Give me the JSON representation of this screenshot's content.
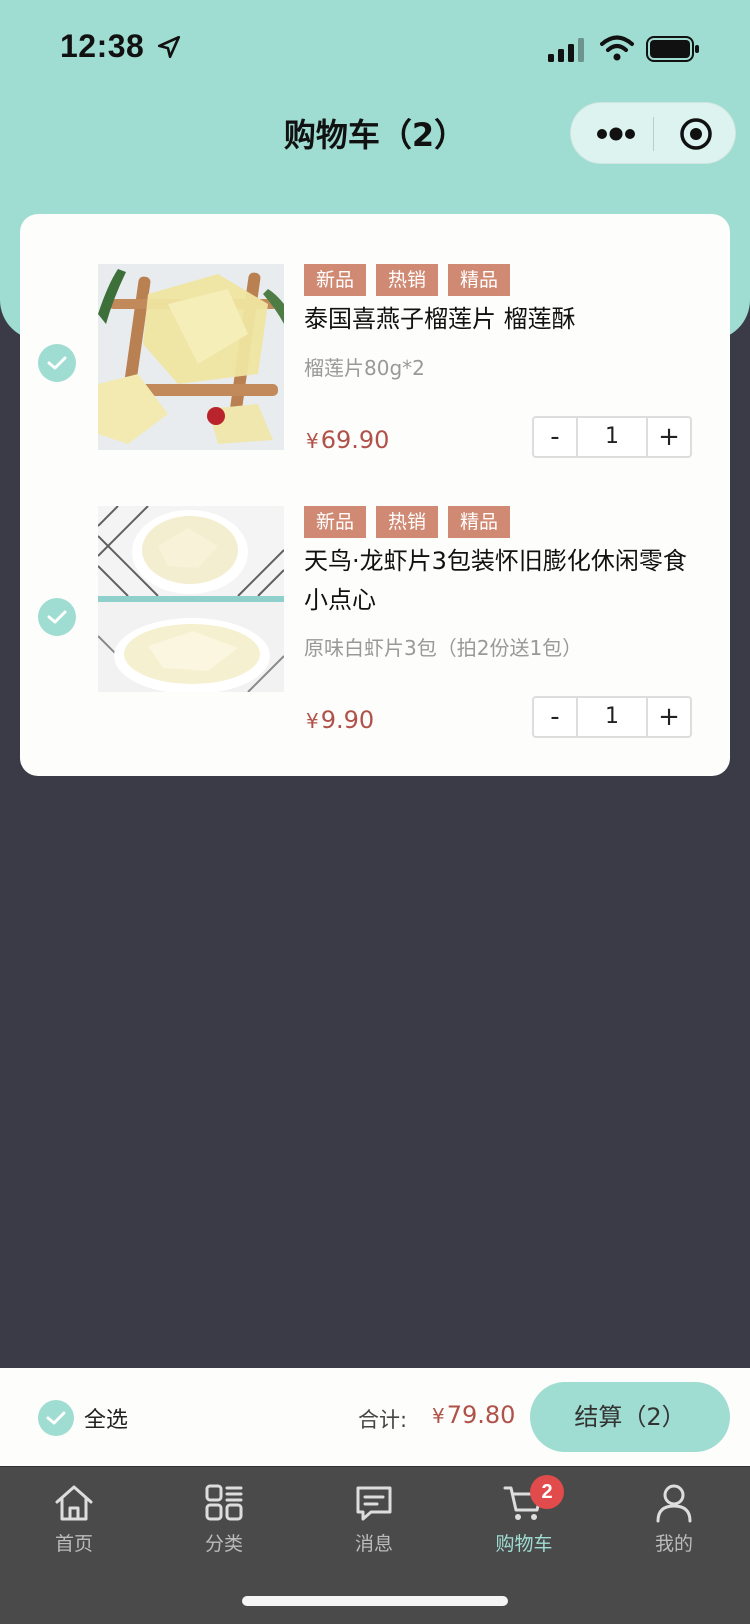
{
  "status_bar": {
    "time": "12:38"
  },
  "nav": {
    "title": "购物车（2）"
  },
  "colors": {
    "accent": "#9fdcd1",
    "price": "#b0524a",
    "tag": "#d08a73",
    "page_bg": "#3b3b47",
    "badge": "#e24b4b"
  },
  "cart": {
    "items": [
      {
        "tags": [
          "新品",
          "热销",
          "精品"
        ],
        "name": "泰国喜燕子榴莲片 榴莲酥",
        "spec": "榴莲片80g*2",
        "currency": "¥",
        "price": "69.90",
        "decrement": "-",
        "quantity": "1",
        "increment": "+",
        "selected": true
      },
      {
        "tags": [
          "新品",
          "热销",
          "精品"
        ],
        "name": "天鸟·龙虾片3包装怀旧膨化休闲零食小点心",
        "spec": "原味白虾片3包（拍2份送1包）",
        "currency": "¥",
        "price": "9.90",
        "decrement": "-",
        "quantity": "1",
        "increment": "+",
        "selected": true
      }
    ]
  },
  "checkout": {
    "select_all": "全选",
    "total_label": "合计:",
    "currency": "¥",
    "total": "79.80",
    "button": "结算（2）"
  },
  "tabbar": {
    "tabs": [
      {
        "label": "首页",
        "icon": "home-icon"
      },
      {
        "label": "分类",
        "icon": "category-icon"
      },
      {
        "label": "消息",
        "icon": "message-icon"
      },
      {
        "label": "购物车",
        "icon": "cart-icon",
        "active": true,
        "badge": "2"
      },
      {
        "label": "我的",
        "icon": "user-icon"
      }
    ]
  }
}
